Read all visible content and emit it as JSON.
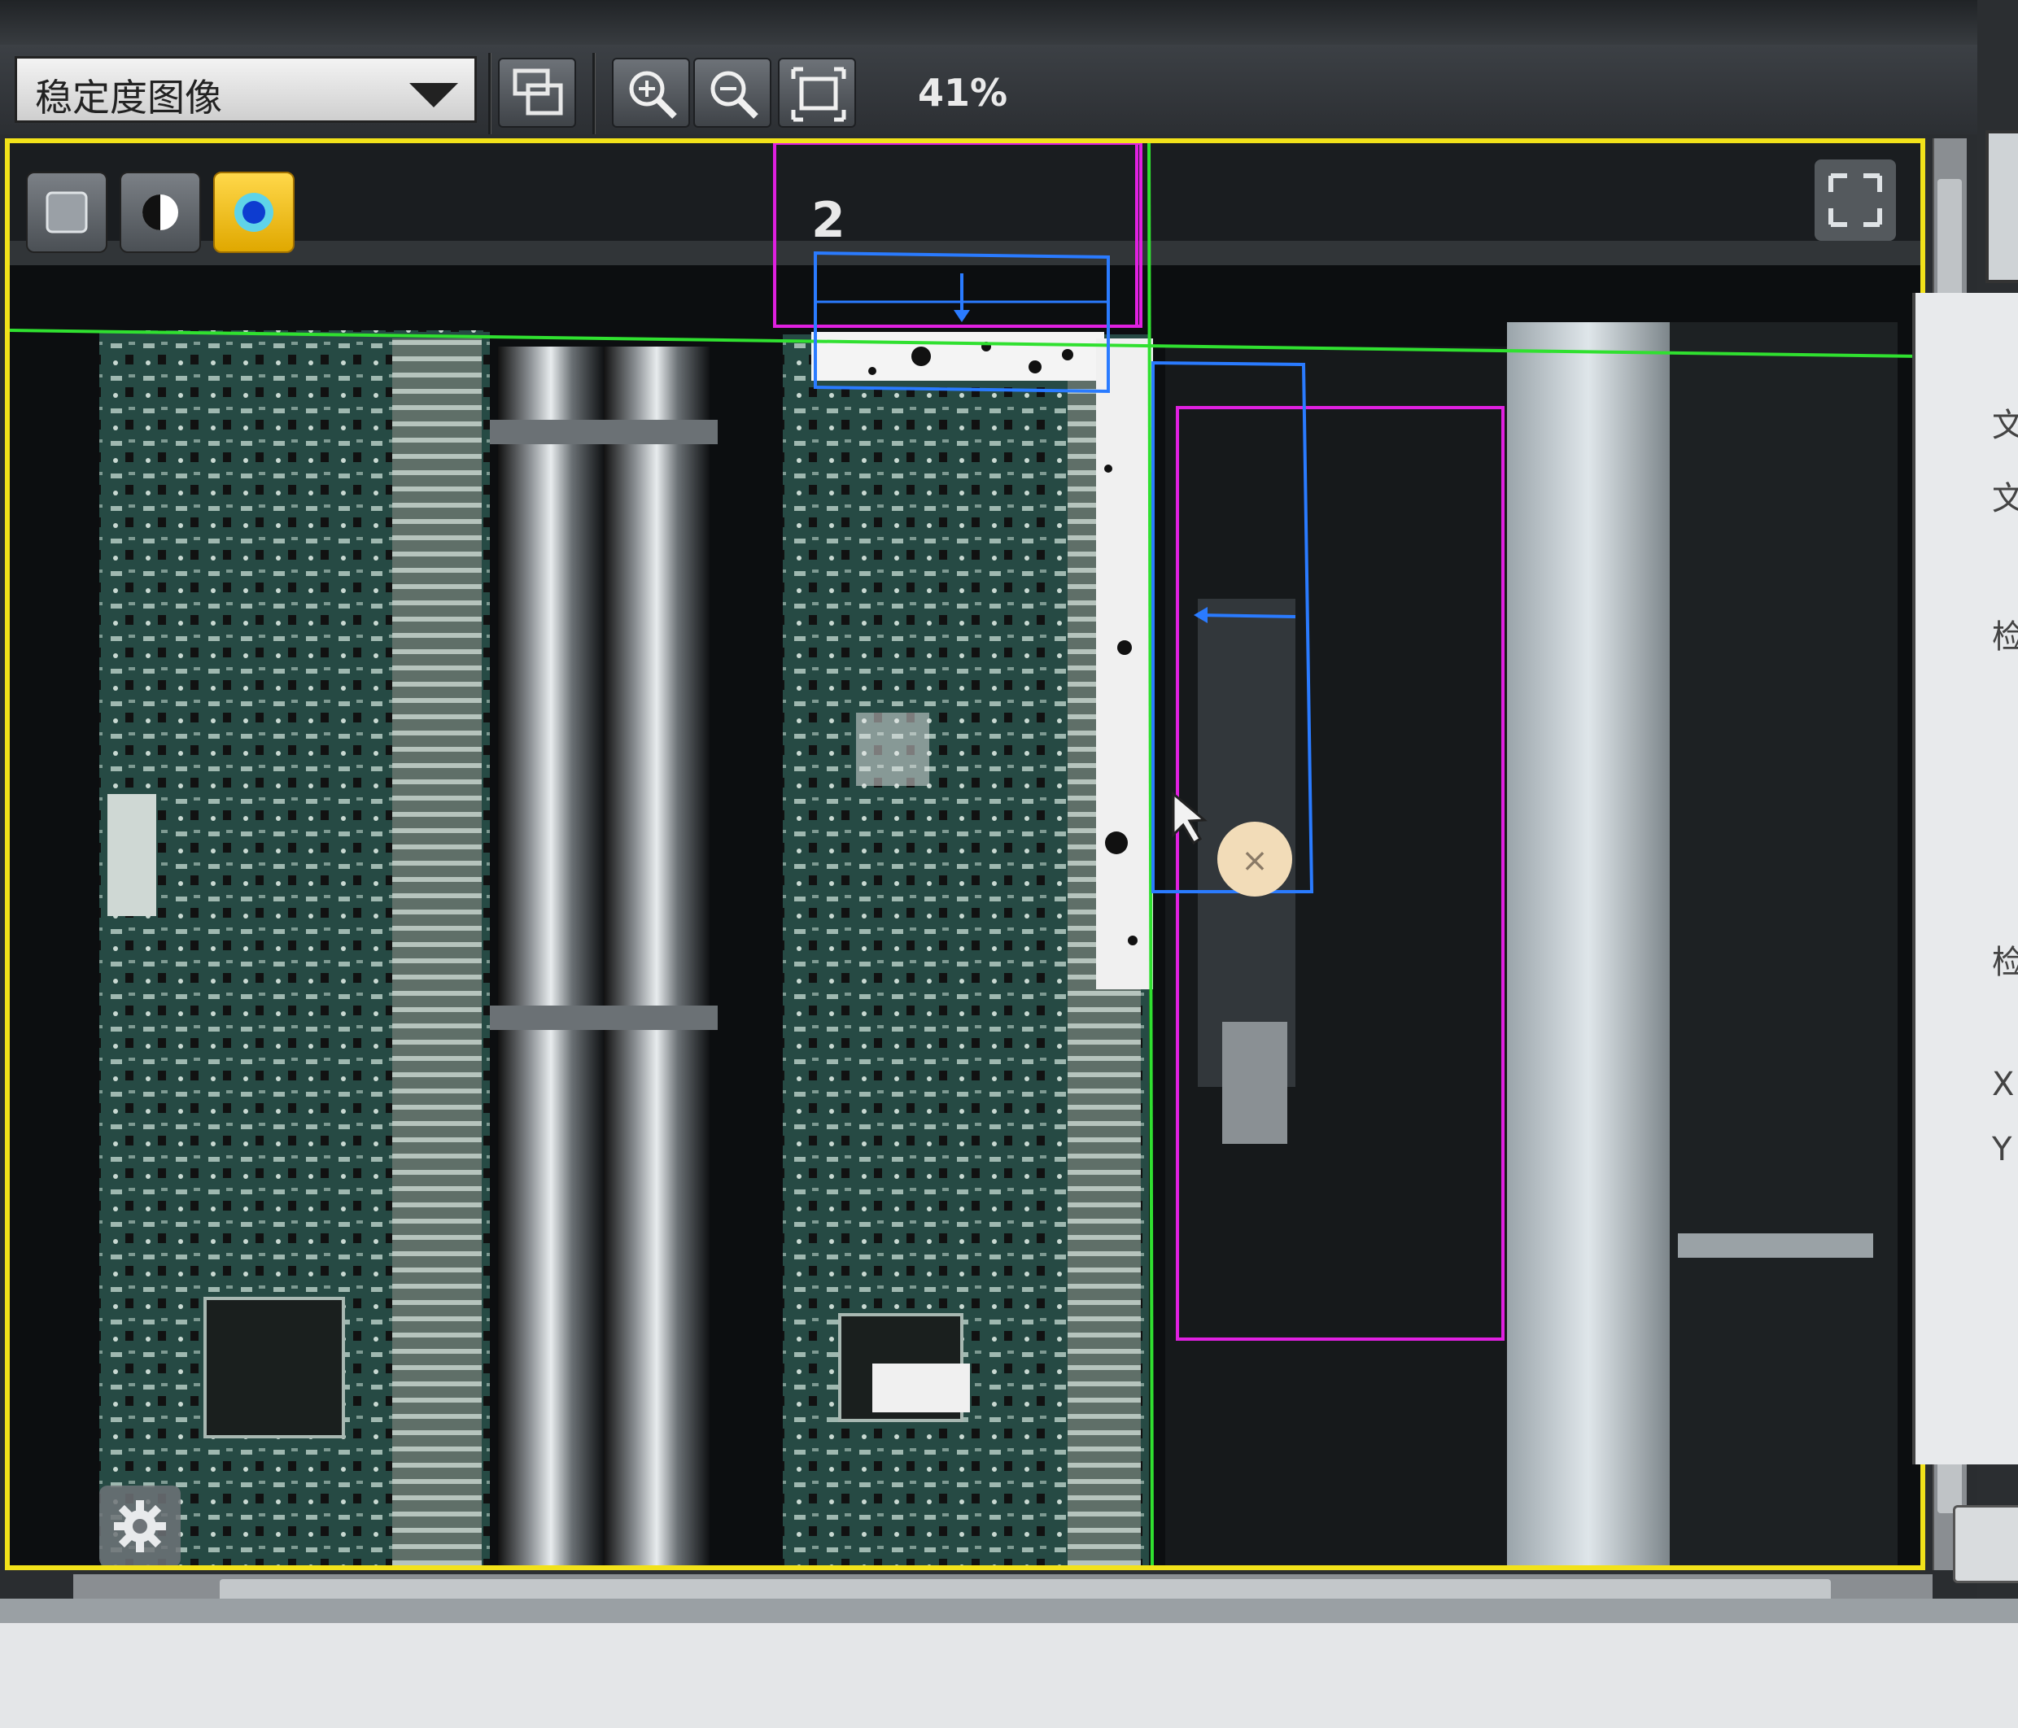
{
  "toolbar": {
    "image_mode_selected": "稳定度图像",
    "zoom_level": "41%",
    "buttons": [
      "roi-button",
      "zoom-in-button",
      "zoom-out-button",
      "fit-to-window-button"
    ]
  },
  "viewport": {
    "roi_label": "2",
    "view_mode_buttons": [
      "gray-mode-button",
      "contrast-mode-button",
      "color-mode-button"
    ],
    "active_view_mode": "color-mode-button"
  },
  "colors": {
    "viewport_border": "#f2e21a",
    "roi_magenta": "#e020e0",
    "roi_blue": "#2a7bff",
    "guide_green": "#30e030",
    "active_button": "#ffd84a"
  },
  "right_panel": {
    "partial_chars": [
      "文",
      "文",
      "检",
      "检",
      "X",
      "Y"
    ]
  }
}
